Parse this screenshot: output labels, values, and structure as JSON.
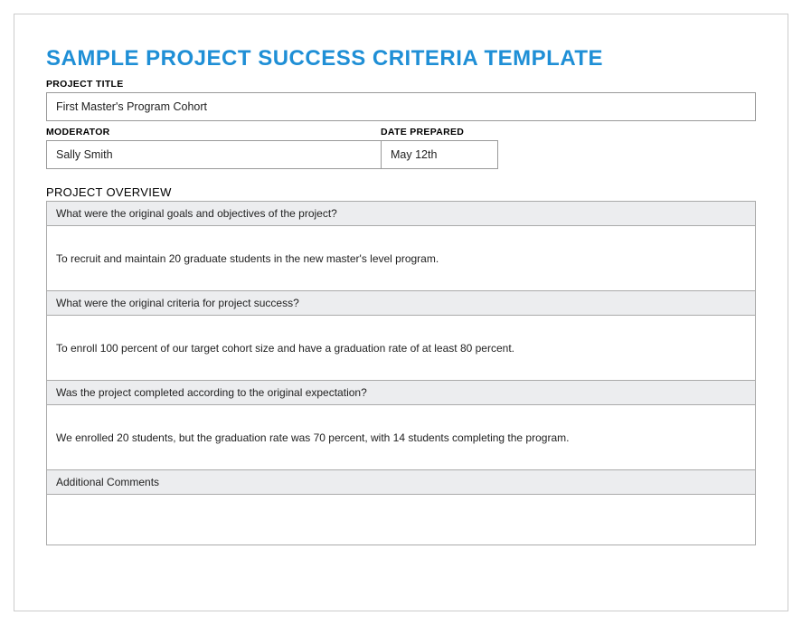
{
  "title": "SAMPLE PROJECT SUCCESS CRITERIA TEMPLATE",
  "fields": {
    "project_title_label": "PROJECT TITLE",
    "project_title_value": "First Master's Program Cohort",
    "moderator_label": "MODERATOR",
    "moderator_value": "Sally Smith",
    "date_label": "DATE PREPARED",
    "date_value": "May 12th"
  },
  "overview": {
    "heading": "PROJECT OVERVIEW",
    "rows": [
      {
        "question": "What were the original goals and objectives of the project?",
        "answer": "To recruit and maintain 20 graduate students in the new master's level program."
      },
      {
        "question": "What were the original criteria for project success?",
        "answer": "To enroll 100 percent of our target cohort size and have a graduation rate of at least 80 percent."
      },
      {
        "question": "Was the project completed according to the original expectation?",
        "answer": "We enrolled 20 students, but the graduation rate was 70 percent, with 14 students completing the program."
      },
      {
        "question": "Additional Comments",
        "answer": ""
      }
    ]
  }
}
